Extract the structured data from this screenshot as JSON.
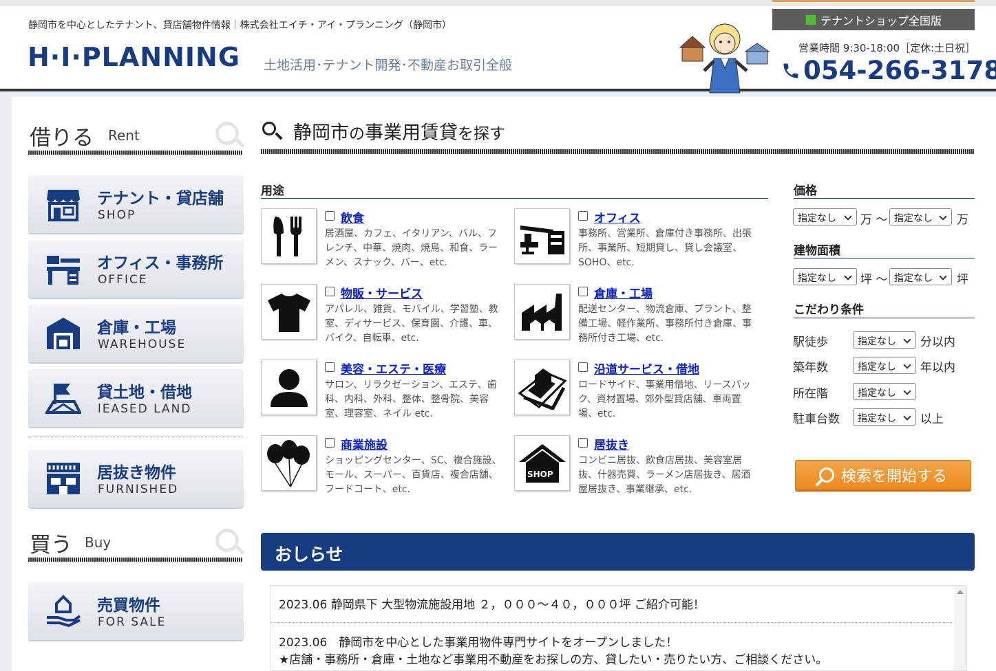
{
  "header": {
    "tagline": "静岡市を中心としたテナント、貸店舗物件情報｜株式会社エイチ・アイ・プランニング（静岡市）",
    "logo": "H·I·PLANNING",
    "logo_sub": "土地活用･テナント開発･不動産お取引全般",
    "shop_button": "テナントショップ全国版",
    "hours": "営業時間 9:30-18:00［定休:土日祝］",
    "phone": "054-266-3178"
  },
  "sidebar": {
    "rent": {
      "ja": "借りる",
      "en": "Rent"
    },
    "buy": {
      "ja": "買う",
      "en": "Buy"
    },
    "rent_items": [
      {
        "title": "テナント・貸店舗",
        "sub": "SHOP",
        "icon": "shop-icon"
      },
      {
        "title": "オフィス・事務所",
        "sub": "OFFICE",
        "icon": "office-icon"
      },
      {
        "title": "倉庫・工場",
        "sub": "WAREHOUSE",
        "icon": "warehouse-icon"
      },
      {
        "title": "貸土地・借地",
        "sub": "lEASED LAND",
        "icon": "land-icon"
      },
      {
        "title": "居抜き物件",
        "sub": "FURNISHED",
        "icon": "furnished-icon"
      }
    ],
    "buy_items": [
      {
        "title": "売買物件",
        "sub": "FOR SALE",
        "icon": "for-sale-icon"
      }
    ]
  },
  "search": {
    "title_city": "静岡市",
    "title_no": "の",
    "title_main": "事業用賃貸",
    "title_end": "を探す",
    "usage_label": "用途",
    "categories": [
      {
        "name": "飲食",
        "desc": "居酒屋、カフェ、イタリアン、バル、フレンチ、中華、焼肉、焼鳥、和食、ラーメン、スナック、バー、etc.",
        "icon": "fork-knife-icon"
      },
      {
        "name": "オフィス",
        "desc": "事務所、営業所、倉庫付き事務所、出張所、事業所、短期貸し、貸し会議室、SOHO、etc.",
        "icon": "desk-icon"
      },
      {
        "name": "物販・サービス",
        "desc": "アパレル、雑貨、モバイル、学習塾、教室、ディサービス、保育園、介護、車、バイク、自転車、etc.",
        "icon": "tshirt-icon"
      },
      {
        "name": "倉庫・工場",
        "desc": "配送センター、物流倉庫、プラント、整備工場、軽作業所、事務所付き倉庫、事務所付き工場、etc.",
        "icon": "factory-icon"
      },
      {
        "name": "美容・エステ・医療",
        "desc": "サロン、リラクゼーション、エステ、歯科、内科、外科、整体、整骨院、美容室、理容室、ネイル etc.",
        "icon": "person-icon"
      },
      {
        "name": "沿道サービス・借地",
        "desc": "ロードサイド、事業用借地、リースバック、資材置場、郊外型貸店舗、車両置場、etc.",
        "icon": "roadside-icon"
      },
      {
        "name": "商業施設",
        "desc": "ショッピングセンター、SC、複合施設、モール、スーパー、百貨店、複合店舗、フードコート、etc.",
        "icon": "balloons-icon"
      },
      {
        "name": "居抜き",
        "desc": "コンビニ居抜、飲食店居抜、美容室居抜、什器売買、ラーメン店居抜き、居酒屋居抜き、事業継承、etc.",
        "icon": "shop-house-icon"
      }
    ],
    "price": {
      "label": "価格",
      "min": "指定なし",
      "unit1": "万 〜",
      "max": "指定なし",
      "unit2": "万"
    },
    "area": {
      "label": "建物面積",
      "min": "指定なし",
      "unit1": "坪 〜",
      "max": "指定なし",
      "unit2": "坪"
    },
    "conditions": {
      "label": "こだわり条件",
      "rows": [
        {
          "label": "駅徒歩",
          "value": "指定なし",
          "suffix": "分以内"
        },
        {
          "label": "築年数",
          "value": "指定なし",
          "suffix": "年以内"
        },
        {
          "label": "所在階",
          "value": "指定なし",
          "suffix": ""
        },
        {
          "label": "駐車台数",
          "value": "指定なし",
          "suffix": "以上"
        }
      ]
    },
    "submit": "検索を開始する"
  },
  "news": {
    "title": "おしらせ",
    "items": [
      "2023.06 静岡県下 大型物流施設用地 ２，０００～４０，０００坪 ご紹介可能！",
      "2023.06　静岡市を中心とした事業用物件専門サイトをオープンしました！",
      "★店舗・事務所・倉庫・土地など事業用不動産をお探しの方、貸したい・売りたい方、ご相談ください。"
    ]
  },
  "colors": {
    "navy": "#173c82",
    "orange": "#eb8a1e",
    "link": "#0b22c7"
  }
}
